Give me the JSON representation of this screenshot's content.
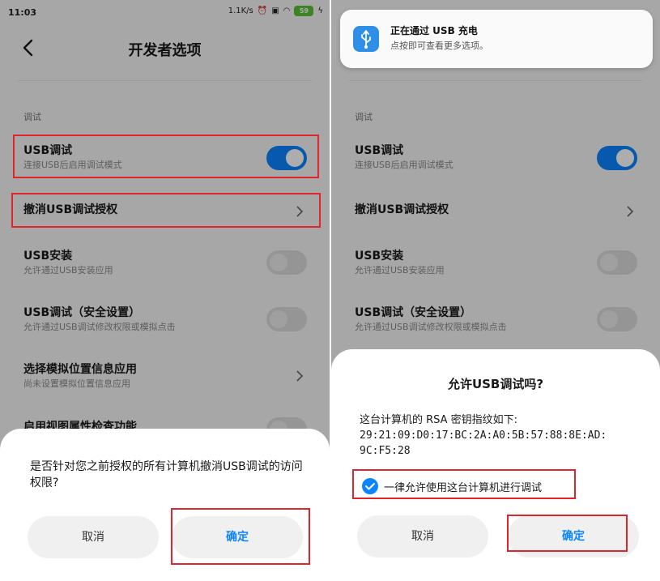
{
  "status_bar": {
    "time": "11:03",
    "speed": "1.1K/s",
    "battery": "59"
  },
  "header": {
    "title": "开发者选项"
  },
  "section": {
    "label": "调试"
  },
  "settings": {
    "usb_debug": {
      "title": "USB调试",
      "subtitle": "连接USB后启用调试模式",
      "enabled": true
    },
    "revoke": {
      "title": "撤消USB调试授权"
    },
    "usb_install": {
      "title": "USB安装",
      "subtitle": "允许通过USB安装应用",
      "enabled": false
    },
    "usb_debug_secure": {
      "title": "USB调试（安全设置）",
      "subtitle": "允许通过USB调试修改权限或模拟点击",
      "enabled": false
    },
    "mock_location": {
      "title": "选择模拟位置信息应用",
      "subtitle": "尚未设置模拟位置信息应用"
    },
    "view_attr": {
      "title": "启用视图属性检查功能"
    }
  },
  "revoke_dialog": {
    "message": "是否针对您之前授权的所有计算机撤消USB调试的访问权限?",
    "cancel": "取消",
    "confirm": "确定"
  },
  "notification": {
    "title": "正在通过 USB 充电",
    "body": "点按即可查看更多选项。"
  },
  "allow_dialog": {
    "title": "允许USB调试吗?",
    "body_line1": "这台计算机的 RSA 密钥指纹如下:",
    "body_line2": "29:21:09:D0:17:BC:2A:A0:5B:57:88:8E:AD:",
    "body_line3": "9C:F5:28",
    "checkbox_label": "一律允许使用这台计算机进行调试",
    "checkbox_checked": true,
    "cancel": "取消",
    "confirm": "确定"
  },
  "colors": {
    "accent": "#0b84ff",
    "highlight": "#e0242b",
    "battery": "#5bc236"
  }
}
